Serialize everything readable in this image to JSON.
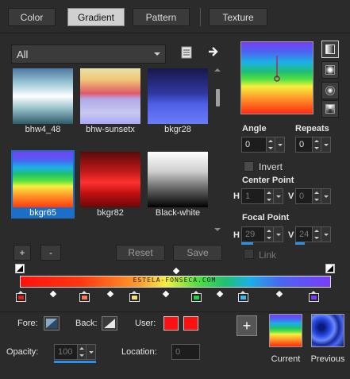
{
  "tabs": [
    {
      "label": "Color"
    },
    {
      "label": "Gradient"
    },
    {
      "label": "Pattern"
    },
    {
      "label": "Texture"
    }
  ],
  "category": {
    "selected": "All"
  },
  "gradients": [
    {
      "name": "bhw4_48"
    },
    {
      "name": "bhw-sunsetx"
    },
    {
      "name": "bkgr28"
    },
    {
      "name": "bkgr65"
    },
    {
      "name": "bkgr82"
    },
    {
      "name": "Black-white"
    }
  ],
  "selected_gradient": "bkgr65",
  "buttons": {
    "add": "+",
    "remove": "-",
    "reset": "Reset",
    "save": "Save"
  },
  "angle": {
    "label": "Angle",
    "value": "0"
  },
  "repeats": {
    "label": "Repeats",
    "value": "0"
  },
  "invert": {
    "label": "Invert",
    "checked": false
  },
  "center_point": {
    "label": "Center Point",
    "h_label": "H",
    "h_value": "1",
    "v_label": "V",
    "v_value": "0"
  },
  "focal_point": {
    "label": "Focal Point",
    "h_label": "H",
    "h_value": "29",
    "v_label": "V",
    "v_value": "24"
  },
  "link": {
    "label": "Link",
    "checked": false
  },
  "watermark": "ESTELA-FONSECA.COM",
  "color_stops": [
    "#e02020",
    "#ff7a50",
    "#f4e070",
    "#22cc44",
    "#3ab8f0",
    "#7a3cf8"
  ],
  "fore": {
    "label": "Fore:"
  },
  "back": {
    "label": "Back:"
  },
  "user": {
    "label": "User:",
    "color1": "#ff1010",
    "color2": "#ff1010"
  },
  "opacity": {
    "label": "Opacity:",
    "value": "100"
  },
  "location": {
    "label": "Location:",
    "value": "0"
  },
  "current": {
    "label": "Current"
  },
  "previous": {
    "label": "Previous"
  }
}
